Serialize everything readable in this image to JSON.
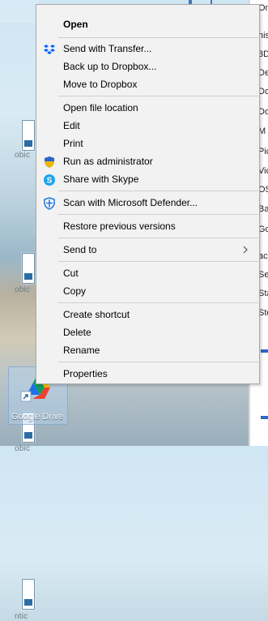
{
  "desktop": {
    "labels": [
      "obic",
      "obic",
      "obic",
      "ntic"
    ],
    "shortcut": {
      "label": "Google Drive",
      "icon": "google-drive-icon"
    }
  },
  "background_window": {
    "rows": [
      "One",
      "his",
      "3D",
      "De",
      "Do",
      "Do",
      "M",
      "Pic",
      "Vic",
      "OS",
      "Ba",
      "Go",
      "ac",
      "Se",
      "Sta",
      "Sto"
    ]
  },
  "context_menu": {
    "items": [
      {
        "label": "Open",
        "bold": true,
        "icon": ""
      },
      {
        "label": "Send with Transfer...",
        "icon": "dropbox-transfer-icon"
      },
      {
        "label": "Back up to Dropbox...",
        "icon": ""
      },
      {
        "label": "Move to Dropbox",
        "icon": ""
      },
      {
        "label": "Open file location",
        "icon": ""
      },
      {
        "label": "Edit",
        "icon": ""
      },
      {
        "label": "Print",
        "icon": ""
      },
      {
        "label": "Run as administrator",
        "icon": "shield-icon"
      },
      {
        "label": "Share with Skype",
        "icon": "skype-icon"
      },
      {
        "label": "Scan with Microsoft Defender...",
        "icon": "defender-icon"
      },
      {
        "label": "Restore previous versions",
        "icon": ""
      },
      {
        "label": "Send to",
        "icon": "chevron-right-icon"
      },
      {
        "label": "Cut",
        "icon": ""
      },
      {
        "label": "Copy",
        "icon": ""
      },
      {
        "label": "Create shortcut",
        "icon": ""
      },
      {
        "label": "Delete",
        "icon": ""
      },
      {
        "label": "Rename",
        "icon": ""
      },
      {
        "label": "Properties",
        "icon": ""
      }
    ]
  },
  "colors": {
    "menu_background": "#f2f2f2",
    "menu_border": "#a9a9a9",
    "accent_blue": "#2d66c7",
    "skype_blue": "#1fa4ee",
    "defender_blue": "#1a73d7",
    "shield_yellow": "#f2b705"
  }
}
